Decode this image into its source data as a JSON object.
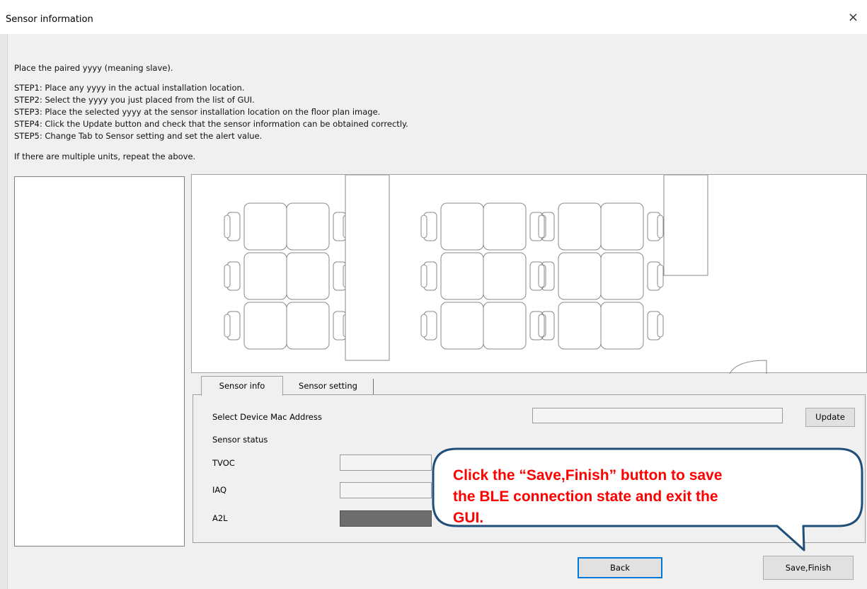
{
  "window": {
    "title": "Sensor information",
    "close_glyph": "×"
  },
  "instructions": {
    "intro": "Place the paired yyyy (meaning slave).",
    "steps": [
      "STEP1: Place any yyyy in the actual installation location.",
      "STEP2: Select the yyyy you just placed from the list of GUI.",
      "STEP3: Place the selected yyyy at the sensor installation location on the floor plan image.",
      "STEP4: Click the Update button and check that the sensor information can be obtained correctly.",
      "STEP5: Change Tab to Sensor setting and set the alert value."
    ],
    "repeat_note": "If there are multiple units, repeat the above."
  },
  "tabs": [
    {
      "label": "Sensor info",
      "active": true
    },
    {
      "label": "Sensor setting",
      "active": false
    }
  ],
  "sensor_info": {
    "mac_label": "Select Device Mac Address",
    "mac_value": "",
    "update_button": "Update",
    "status_label": "Sensor status",
    "rows": [
      {
        "label": "TVOC",
        "value": ""
      },
      {
        "label": "IAQ",
        "value": ""
      },
      {
        "label": "A2L",
        "value": ""
      }
    ]
  },
  "buttons": {
    "back": "Back",
    "save_finish": "Save,Finish"
  },
  "callout": {
    "text_lines": [
      "Click the “Save,Finish” button to save",
      "the BLE connection state and exit the",
      "GUI."
    ]
  },
  "colors": {
    "callout_border": "#1f4e79",
    "callout_text": "#ff0000",
    "a2l_fill": "#6d6d6d",
    "default_button_border": "#0078d7"
  }
}
